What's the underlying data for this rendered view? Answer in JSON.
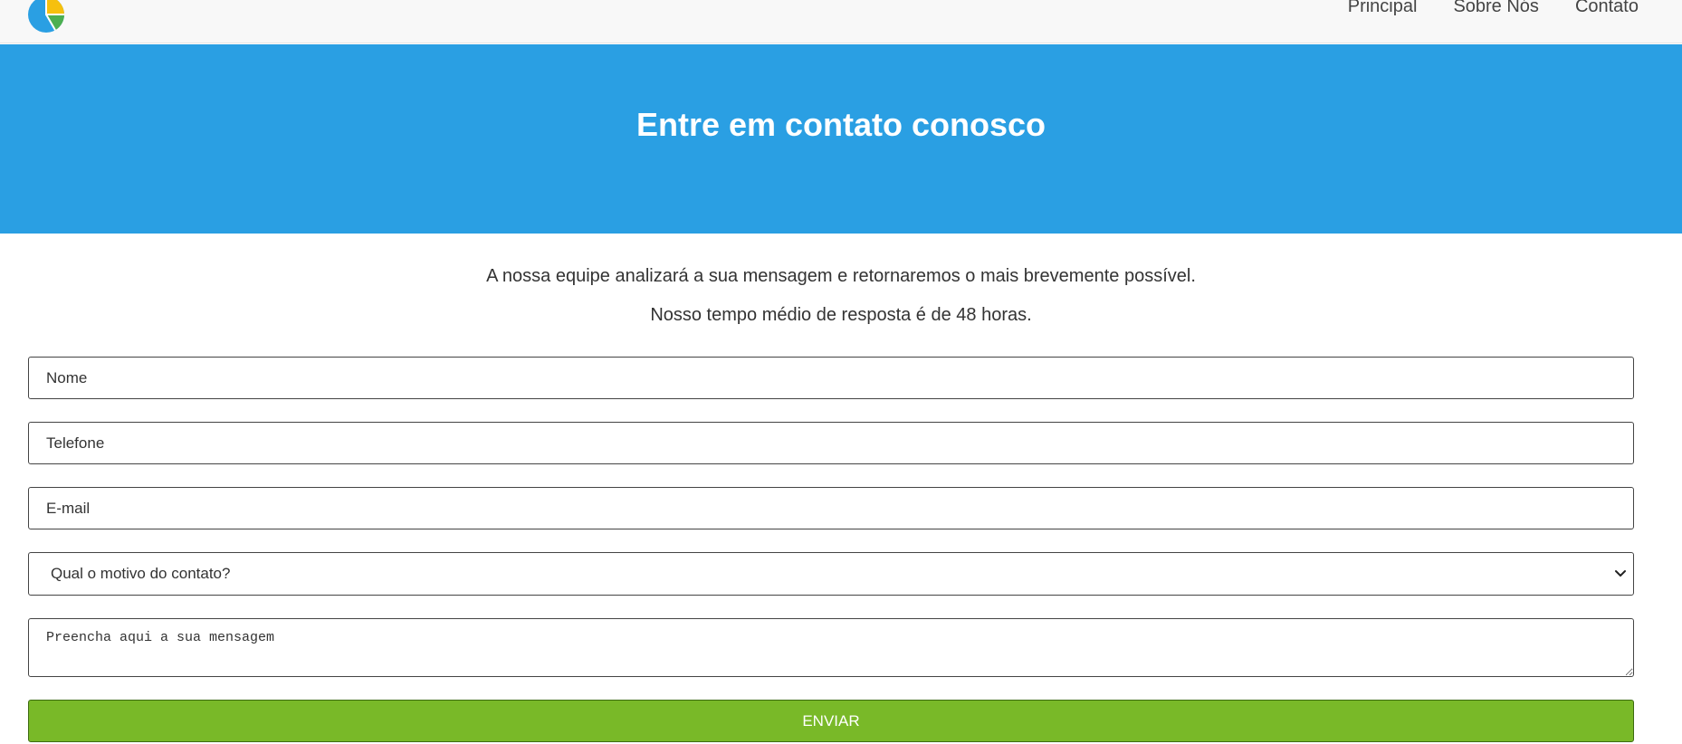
{
  "header": {
    "logo_icon": "pie-chart-logo-icon",
    "nav": [
      {
        "label": "Principal"
      },
      {
        "label": "Sobre Nós"
      },
      {
        "label": "Contato"
      }
    ]
  },
  "hero": {
    "title": "Entre em contato conosco",
    "background": "#2a9fe3"
  },
  "intro": {
    "line1": "A nossa equipe analizará a sua mensagem e retornaremos o mais brevemente possível.",
    "line2": "Nosso tempo médio de resposta é de 48 horas."
  },
  "form": {
    "name_placeholder": "Nome",
    "phone_placeholder": "Telefone",
    "email_placeholder": "E-mail",
    "reason_selected": "Qual o motivo do contato?",
    "message_placeholder": "Preencha aqui a sua mensagem",
    "submit_label": "ENVIAR",
    "submit_color": "#79b928"
  }
}
